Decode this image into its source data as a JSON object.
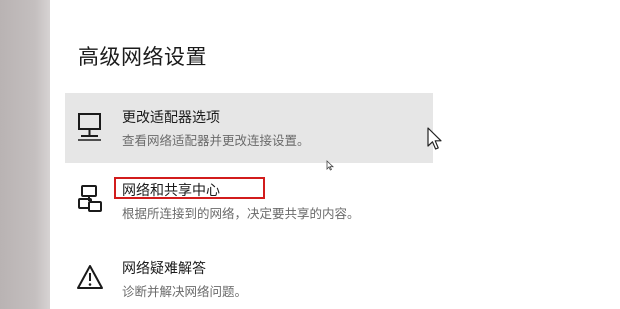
{
  "section": {
    "title": "高级网络设置"
  },
  "items": [
    {
      "title": "更改适配器选项",
      "description": "查看网络适配器并更改连接设置。",
      "icon": "monitor-network-icon"
    },
    {
      "title": "网络和共享中心",
      "description": "根据所连接到的网络，决定要共享的内容。",
      "icon": "network-share-icon"
    },
    {
      "title": "网络疑难解答",
      "description": "诊断并解决网络问题。",
      "icon": "warning-icon"
    }
  ],
  "colors": {
    "hover_background": "#e6e6e6",
    "highlight_border": "#d21c1c"
  }
}
